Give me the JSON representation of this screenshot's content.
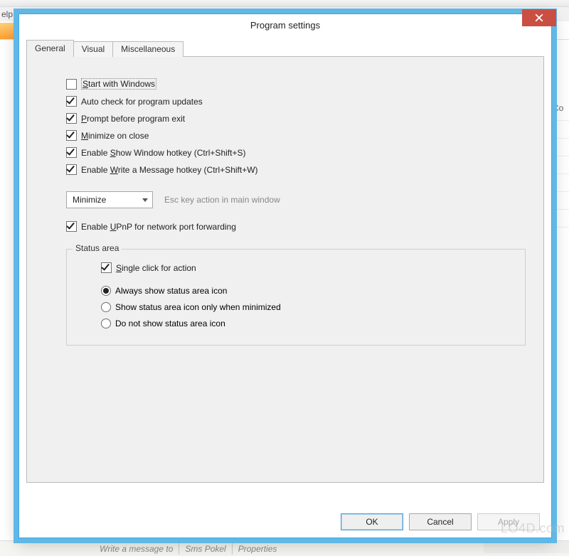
{
  "bg": {
    "menu_fragment": "elp",
    "col_fragment": "Co",
    "bottom_write": "Write a message to",
    "bottom_sms": "Sms Pokel",
    "bottom_props": "Properties"
  },
  "dialog": {
    "title": "Program settings",
    "close_name": "close"
  },
  "tabs": {
    "general": "General",
    "visual": "Visual",
    "misc": "Miscellaneous"
  },
  "opts": {
    "start_pre": "",
    "start_u": "S",
    "start_post": "tart with Windows",
    "auto": "Auto check for program updates",
    "auto_u": "",
    "auto_post": "",
    "prompt_pre": "",
    "prompt_u": "P",
    "prompt_post": "rompt before program exit",
    "min_pre": "",
    "min_u": "M",
    "min_post": "inimize on close",
    "show_pre": "Enable ",
    "show_u": "S",
    "show_post": "how Window hotkey (Ctrl+Shift+S)",
    "write_pre": "Enable ",
    "write_u": "W",
    "write_post": "rite a Message hotkey (Ctrl+Shift+W)",
    "upnp_pre": "Enable ",
    "upnp_u": "U",
    "upnp_post": "PnP for network port forwarding"
  },
  "esc": {
    "value": "Minimize",
    "hint": "Esc key action in main window"
  },
  "status": {
    "title": "Status area",
    "single_pre": "",
    "single_u": "S",
    "single_post": "ingle click for action",
    "r1_pre": "",
    "r1_u": "A",
    "r1_post": "lways show status area icon",
    "r2": "Show status area icon only when minimized",
    "r3": "Do not show status area icon"
  },
  "buttons": {
    "ok": "OK",
    "cancel": "Cancel",
    "apply": "Apply"
  },
  "watermark": "LO4D.com"
}
